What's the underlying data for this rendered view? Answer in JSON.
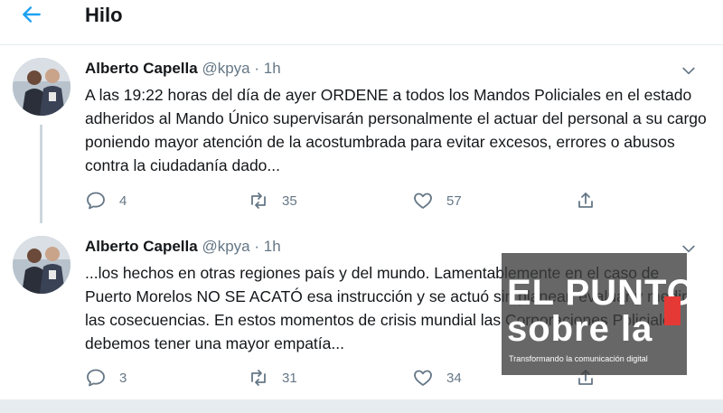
{
  "header": {
    "back_icon": "arrow-left-icon",
    "title": "Hilo"
  },
  "tweets": [
    {
      "author": "Alberto Capella",
      "handle": "@kpya",
      "separator": "·",
      "time": "1h",
      "text": "A las 19:22 horas del día de ayer ORDENE a todos los Mandos Policiales en el estado adheridos al Mando Único supervisarán personalmente el actuar del personal a su cargo poniendo mayor atención de la acostumbrada para evitar excesos, errores o abusos contra la ciudadanía dado...",
      "replies": "4",
      "retweets": "35",
      "likes": "57"
    },
    {
      "author": "Alberto Capella",
      "handle": "@kpya",
      "separator": "·",
      "time": "1h",
      "text": "...los hechos en otras regiones país y del mundo. Lamentablemente en el caso de Puerto Morelos NO SE ACATÓ esa instrucción y se actuó sin planear, evaluar y medir las cosecuencias. En estos momentos de crisis mundial las Corporaciones Policiales debemos tener una mayor empatía...",
      "replies": "3",
      "retweets": "31",
      "likes": "34"
    }
  ],
  "watermark": {
    "line1": "EL PUNTO",
    "line2": "sobre la",
    "tagline": "Transformando la comunicación digital"
  },
  "colors": {
    "accent": "#1da1f2",
    "muted": "#657786",
    "border": "#e6ecf0"
  }
}
